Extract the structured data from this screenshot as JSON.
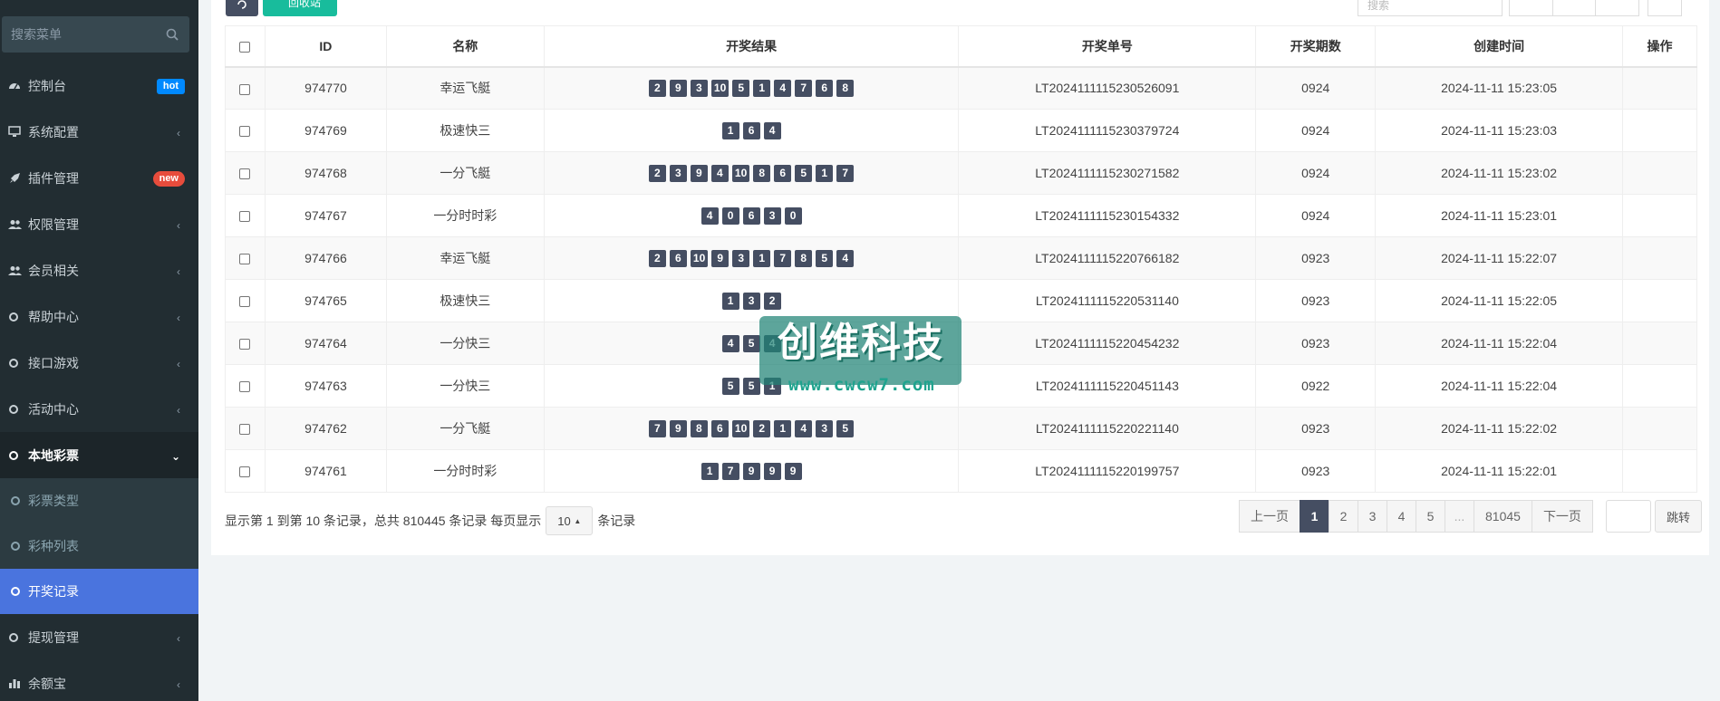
{
  "sidebar": {
    "search_placeholder": "搜索菜单",
    "items": [
      {
        "label": "控制台",
        "badge": "hot"
      },
      {
        "label": "系统配置"
      },
      {
        "label": "插件管理",
        "badge": "new"
      },
      {
        "label": "权限管理"
      },
      {
        "label": "会员相关"
      },
      {
        "label": "帮助中心"
      },
      {
        "label": "接口游戏"
      },
      {
        "label": "活动中心"
      },
      {
        "label": "本地彩票"
      },
      {
        "label": "提现管理"
      },
      {
        "label": "余额宝"
      }
    ],
    "submenu": [
      "彩票类型",
      "彩种列表",
      "开奖记录"
    ]
  },
  "toolbar": {
    "recycle_label": "回收站",
    "search_placeholder": "搜索"
  },
  "table": {
    "headers": [
      "ID",
      "名称",
      "开奖结果",
      "开奖单号",
      "开奖期数",
      "创建时间",
      "操作"
    ],
    "rows": [
      {
        "id": "974770",
        "name": "幸运飞艇",
        "balls": [
          "2",
          "9",
          "3",
          "10",
          "5",
          "1",
          "4",
          "7",
          "6",
          "8"
        ],
        "order": "LT2024111115230526091",
        "period": "0924",
        "time": "2024-11-11 15:23:05"
      },
      {
        "id": "974769",
        "name": "极速快三",
        "balls": [
          "1",
          "6",
          "4"
        ],
        "order": "LT2024111115230379724",
        "period": "0924",
        "time": "2024-11-11 15:23:03"
      },
      {
        "id": "974768",
        "name": "一分飞艇",
        "balls": [
          "2",
          "3",
          "9",
          "4",
          "10",
          "8",
          "6",
          "5",
          "1",
          "7"
        ],
        "order": "LT2024111115230271582",
        "period": "0924",
        "time": "2024-11-11 15:23:02"
      },
      {
        "id": "974767",
        "name": "一分时时彩",
        "balls": [
          "4",
          "0",
          "6",
          "3",
          "0"
        ],
        "order": "LT2024111115230154332",
        "period": "0924",
        "time": "2024-11-11 15:23:01"
      },
      {
        "id": "974766",
        "name": "幸运飞艇",
        "balls": [
          "2",
          "6",
          "10",
          "9",
          "3",
          "1",
          "7",
          "8",
          "5",
          "4"
        ],
        "order": "LT2024111115220766182",
        "period": "0923",
        "time": "2024-11-11 15:22:07"
      },
      {
        "id": "974765",
        "name": "极速快三",
        "balls": [
          "1",
          "3",
          "2"
        ],
        "order": "LT2024111115220531140",
        "period": "0923",
        "time": "2024-11-11 15:22:05"
      },
      {
        "id": "974764",
        "name": "一分快三",
        "balls": [
          "4",
          "5",
          "4"
        ],
        "order": "LT2024111115220454232",
        "period": "0923",
        "time": "2024-11-11 15:22:04"
      },
      {
        "id": "974763",
        "name": "一分快三",
        "balls": [
          "5",
          "5",
          "1"
        ],
        "order": "LT2024111115220451143",
        "period": "0922",
        "time": "2024-11-11 15:22:04"
      },
      {
        "id": "974762",
        "name": "一分飞艇",
        "balls": [
          "7",
          "9",
          "8",
          "6",
          "10",
          "2",
          "1",
          "4",
          "3",
          "5"
        ],
        "order": "LT2024111115220221140",
        "period": "0923",
        "time": "2024-11-11 15:22:02"
      },
      {
        "id": "974761",
        "name": "一分时时彩",
        "balls": [
          "1",
          "7",
          "9",
          "9",
          "9"
        ],
        "order": "LT2024111115220199757",
        "period": "0923",
        "time": "2024-11-11 15:22:01"
      }
    ]
  },
  "pagination": {
    "info_prefix": "显示第 1 到第 10 条记录，总共 810445 条记录 每页显示",
    "page_size": "10",
    "info_suffix": "条记录",
    "prev": "上一页",
    "pages": [
      "1",
      "2",
      "3",
      "4",
      "5",
      "...",
      "81045"
    ],
    "next": "下一页",
    "jump": "跳转"
  },
  "watermark": {
    "title": "创维科技",
    "url": "www.cwcw7.com"
  },
  "colors": {
    "sidebar_bg": "#222d32",
    "active_menu": "#4a74de",
    "ball_bg": "#454e62",
    "recycle_btn": "#18bc9c"
  }
}
